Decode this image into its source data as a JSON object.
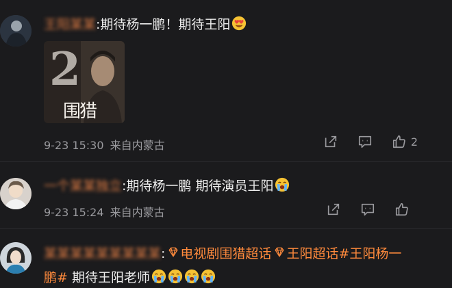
{
  "comments": [
    {
      "user": "王阳某某",
      "prefix": ":",
      "text": "期待杨一鹏！期待王阳",
      "image": {
        "number": "2",
        "title": "围猎"
      },
      "time": "9-23 15:30",
      "location": "来自内蒙古",
      "likes": "2"
    },
    {
      "user": "一个某某独立",
      "prefix": ":",
      "text": "期待杨一鹏 期待演员王阳",
      "time": "9-23 15:24",
      "location": "来自内蒙古",
      "likes": ""
    },
    {
      "user": "某某某某某某某某某",
      "prefix": ":",
      "topic1": "电视剧围猎超话",
      "topic2": "王阳超话",
      "topic3_part1": "#王阳杨一",
      "topic3_part2": "鹏#",
      "text": " 期待王阳老师"
    }
  ],
  "icons": {
    "share": "share-icon",
    "comment": "comment-icon",
    "like": "thumbs-up-icon",
    "topic": "diamond-topic-icon",
    "emoji_heart_eyes": "heart-eyes-emoji",
    "emoji_cry": "crying-emoji"
  },
  "colors": {
    "background": "#1b1b1d",
    "username": "#e07c43",
    "topic": "#ff8a3c",
    "meta": "#9a9a9e"
  }
}
